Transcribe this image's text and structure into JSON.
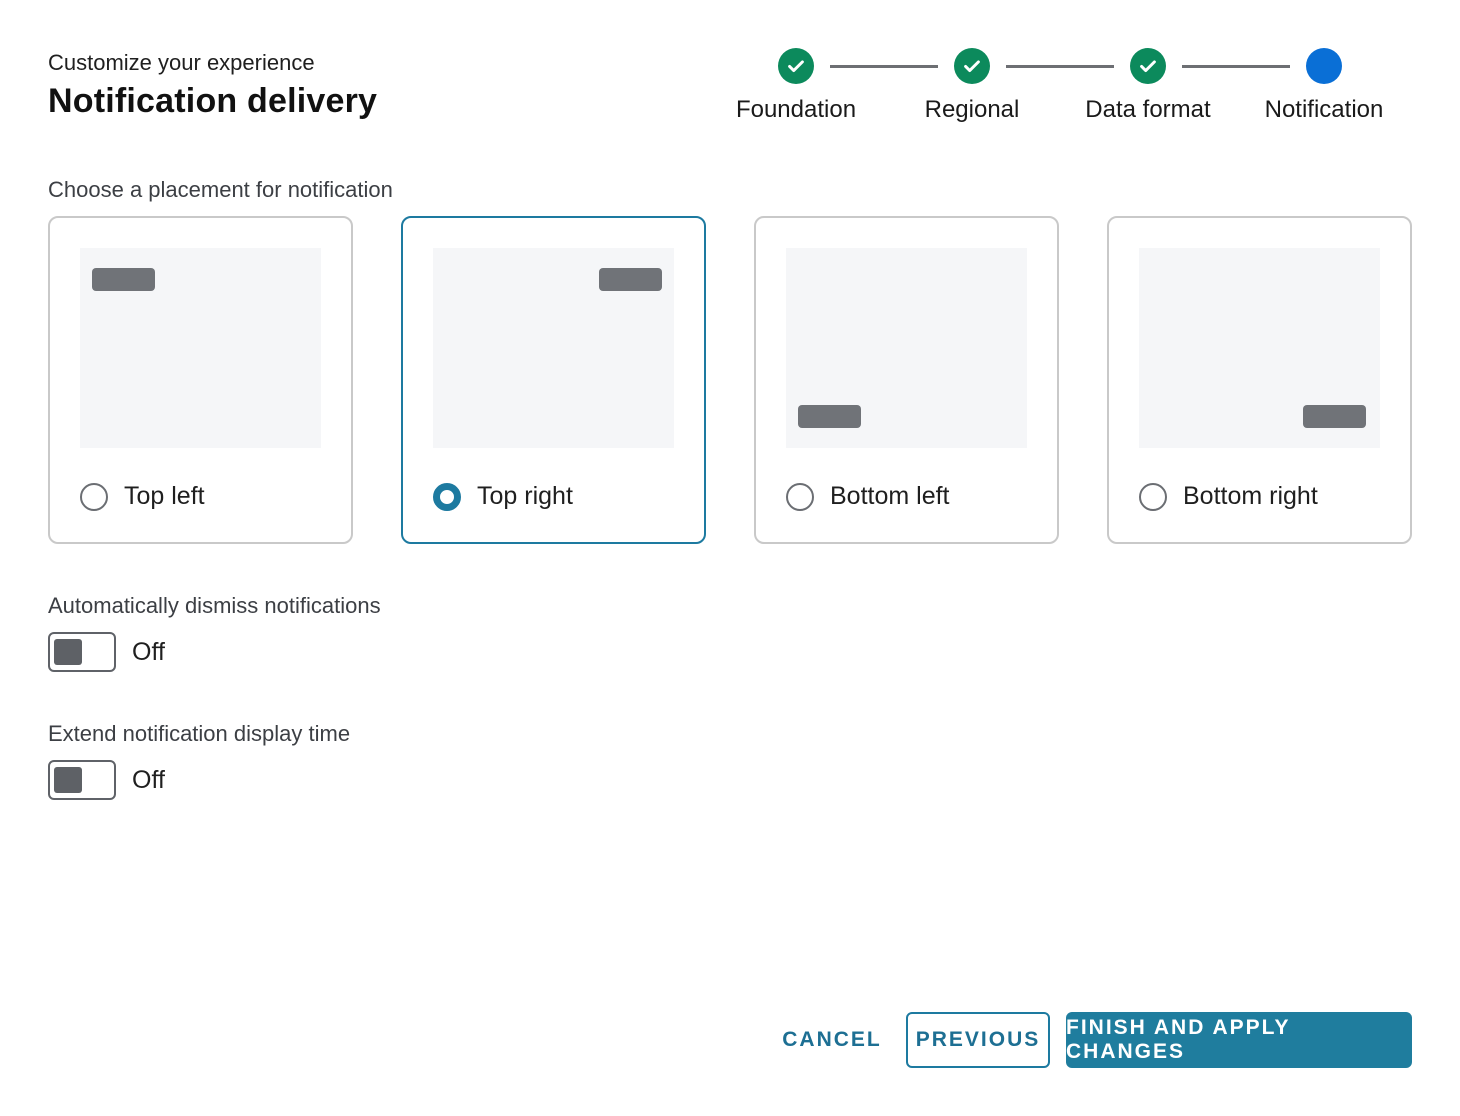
{
  "header": {
    "eyebrow": "Customize your experience",
    "title": "Notification delivery"
  },
  "stepper": {
    "steps": [
      {
        "label": "Foundation",
        "status": "complete",
        "icon": "check-icon"
      },
      {
        "label": "Regional",
        "status": "complete",
        "icon": "check-icon"
      },
      {
        "label": "Data format",
        "status": "complete",
        "icon": "check-icon"
      },
      {
        "label": "Notification",
        "status": "current"
      }
    ]
  },
  "placement": {
    "label": "Choose a placement for notification",
    "selected": "Top right",
    "options": [
      {
        "label": "Top left",
        "checked": false
      },
      {
        "label": "Top right",
        "checked": true
      },
      {
        "label": "Bottom left",
        "checked": false
      },
      {
        "label": "Bottom right",
        "checked": false
      }
    ]
  },
  "auto_dismiss": {
    "label": "Automatically dismiss notifications",
    "state": "Off"
  },
  "extend_display": {
    "label": "Extend notification display time",
    "state": "Off"
  },
  "actions": {
    "cancel": "CANCEL",
    "previous": "PREVIOUS",
    "finish": "FINISH AND APPLY CHANGES"
  },
  "colors": {
    "accent": "#1d7aa0",
    "step_complete": "#0c8a5c",
    "step_current": "#0a6fd6"
  }
}
